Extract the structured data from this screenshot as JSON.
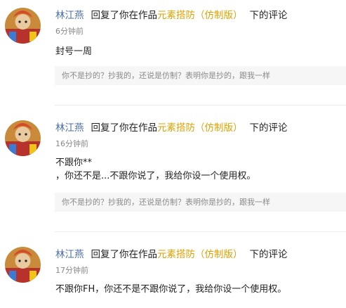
{
  "comments": [
    {
      "author": "林江燕",
      "action": "回复了你在作品",
      "work": "元素搭防（仿制版）",
      "suffix": "下的评论",
      "time": "6分钟前",
      "body": [
        "封号一周"
      ],
      "quote": "你不是抄的？抄我的，还说是仿制？表明你是抄的，跟我一样"
    },
    {
      "author": "林江燕",
      "action": "回复了你在作品",
      "work": "元素搭防（仿制版）",
      "suffix": "下的评论",
      "time": "16分钟前",
      "body": [
        "不跟你**",
        "，你还不是...不跟你说了，我给你设一个使用权。"
      ],
      "quote": "你不是抄的？抄我的，还说是仿制？表明你是抄的，跟我一样"
    },
    {
      "author": "林江燕",
      "action": "回复了你在作品",
      "work": "元素搭防（仿制版）",
      "suffix": "下的评论",
      "time": "17分钟前",
      "body": [
        "不跟你FH，你还不是不跟你说了，我给你设一个使用权。"
      ]
    }
  ],
  "colors": {
    "author": "#4a6ea9",
    "work_link": "#e0a100",
    "quote_bg": "#f6f6f6",
    "time": "#888888"
  },
  "icons": {
    "avatar": "avatar-image"
  }
}
